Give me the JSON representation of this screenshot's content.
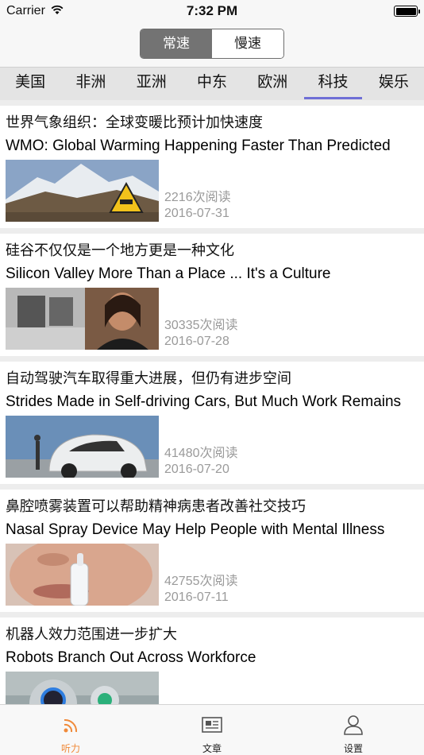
{
  "status_bar": {
    "carrier": "Carrier",
    "time": "7:32 PM"
  },
  "speed_toggle": {
    "options": [
      "常速",
      "慢速"
    ],
    "selected": "常速"
  },
  "channels": {
    "items": [
      "美国",
      "非洲",
      "亚洲",
      "中东",
      "欧洲",
      "科技",
      "娱乐"
    ],
    "selected": "科技",
    "accent_color": "#6f6fd6"
  },
  "articles": [
    {
      "title_zh": "世界气象组织：全球变暖比预计加快速度",
      "title_en": "WMO: Global Warming Happening Faster Than Predicted",
      "reads": "2216次阅读",
      "date": "2016-07-31",
      "thumbnail": "mountain-warning-sign"
    },
    {
      "title_zh": "硅谷不仅仅是一个地方更是一种文化",
      "title_en": "Silicon Valley More Than a Place ... It's a Culture",
      "reads": "30335次阅读",
      "date": "2016-07-28",
      "thumbnail": "office-woman-portrait"
    },
    {
      "title_zh": "自动驾驶汽车取得重大进展，但仍有进步空间",
      "title_en": "Strides Made in Self-driving Cars, But Much Work Remains",
      "reads": "41480次阅读",
      "date": "2016-07-20",
      "thumbnail": "self-driving-car"
    },
    {
      "title_zh": "鼻腔喷雾装置可以帮助精神病患者改善社交技巧",
      "title_en": "Nasal Spray Device May Help People with Mental Illness",
      "reads": "42755次阅读",
      "date": "2016-07-11",
      "thumbnail": "nasal-spray"
    },
    {
      "title_zh": "机器人效力范围进一步扩大",
      "title_en": "Robots Branch Out Across Workforce",
      "reads": "",
      "date": "",
      "thumbnail": "robot-head"
    }
  ],
  "tab_bar": {
    "items": [
      {
        "label": "听力",
        "icon": "rss-icon"
      },
      {
        "label": "文章",
        "icon": "newspaper-icon"
      },
      {
        "label": "设置",
        "icon": "person-icon"
      }
    ],
    "selected": "听力",
    "active_color": "#f08a3a"
  }
}
